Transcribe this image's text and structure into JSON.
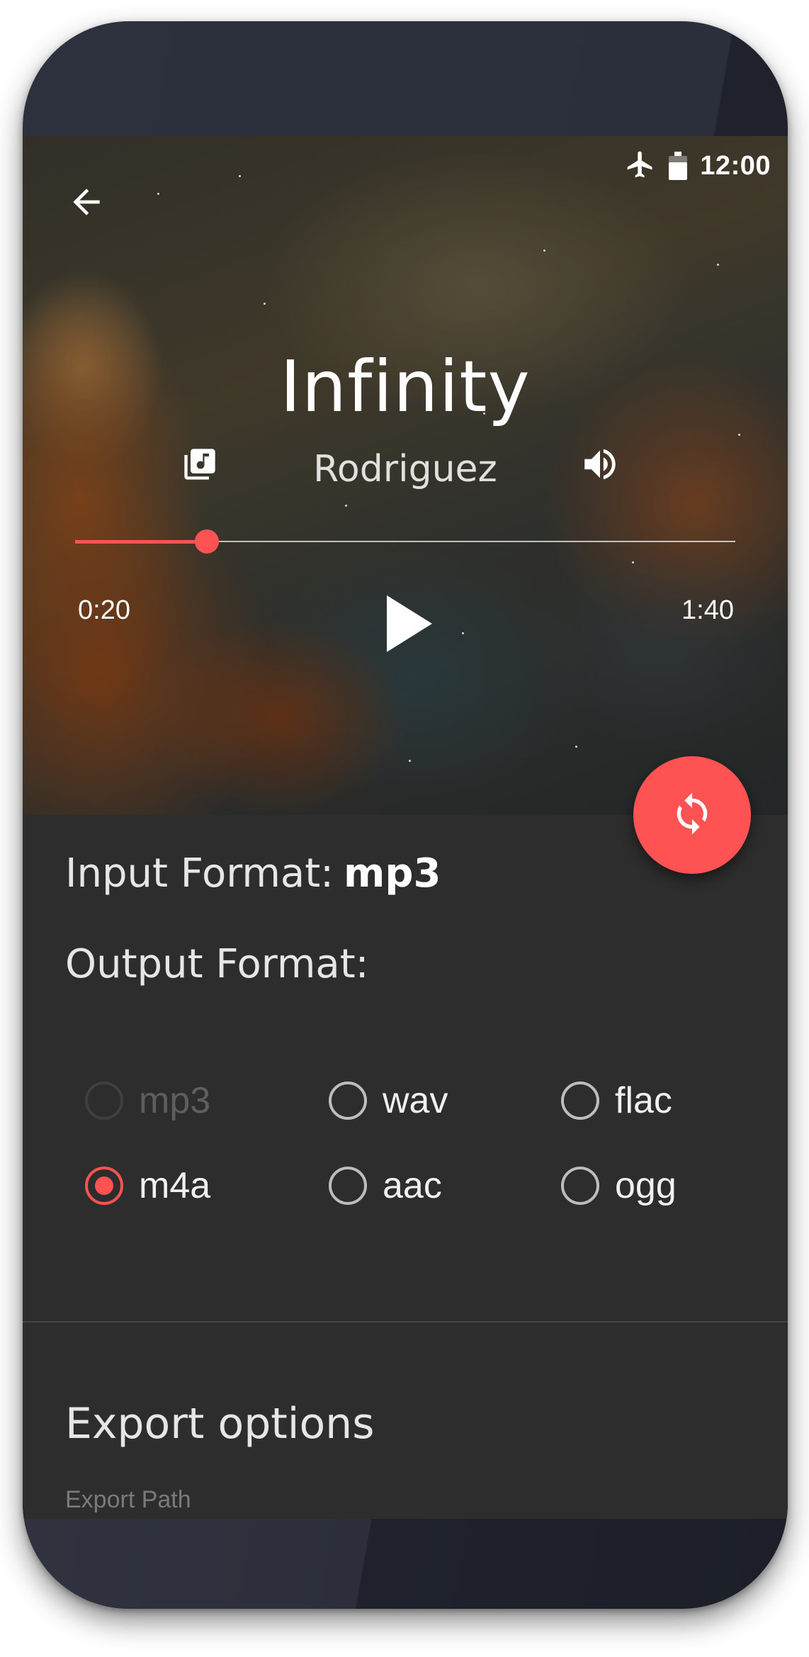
{
  "status_bar": {
    "time": "12:00",
    "icons": [
      "airplane-icon",
      "battery-icon"
    ],
    "battery_level": 0.75
  },
  "header": {
    "back_icon": "arrow-back-icon"
  },
  "track": {
    "title": "Infinity",
    "artist": "Rodriguez",
    "playlist_icon": "library-music-icon",
    "volume_icon": "volume-up-icon"
  },
  "player": {
    "elapsed": "0:20",
    "total": "1:40",
    "progress": 0.2,
    "play_icon": "play-icon"
  },
  "fab": {
    "icon": "convert-sync-icon"
  },
  "format": {
    "input_label": "Input Format:",
    "input_value": "mp3",
    "output_label": "Output Format:",
    "options": [
      {
        "label": "mp3",
        "state": "disabled"
      },
      {
        "label": "wav",
        "state": "unchecked"
      },
      {
        "label": "flac",
        "state": "unchecked"
      },
      {
        "label": "m4a",
        "state": "checked"
      },
      {
        "label": "aac",
        "state": "unchecked"
      },
      {
        "label": "ogg",
        "state": "unchecked"
      }
    ]
  },
  "export": {
    "title": "Export options",
    "path_label": "Export Path"
  },
  "colors": {
    "accent": "#ff5252",
    "surface": "#2d2d2d",
    "device": "#2b2f3b"
  }
}
